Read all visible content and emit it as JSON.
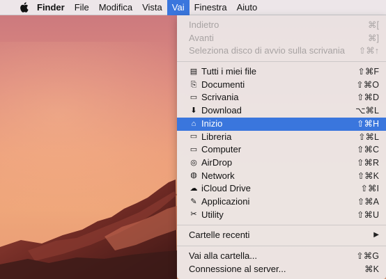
{
  "menubar": {
    "app_name": "Finder",
    "items": [
      "File",
      "Modifica",
      "Vista",
      "Vai",
      "Finestra",
      "Aiuto"
    ],
    "active_item": "Vai"
  },
  "menu": {
    "history": [
      {
        "label": "Indietro",
        "shortcut": "⌘[",
        "enabled": false
      },
      {
        "label": "Avanti",
        "shortcut": "⌘]",
        "enabled": false
      },
      {
        "label": "Seleziona disco di avvio sulla scrivania",
        "shortcut": "⇧⌘↑",
        "enabled": false
      }
    ],
    "places": [
      {
        "label": "Tutti i miei file",
        "shortcut": "⇧⌘F",
        "icon": "all-files-icon",
        "glyph": "▤"
      },
      {
        "label": "Documenti",
        "shortcut": "⇧⌘O",
        "icon": "documents-icon",
        "glyph": "⎘"
      },
      {
        "label": "Scrivania",
        "shortcut": "⇧⌘D",
        "icon": "desktop-icon",
        "glyph": "▭"
      },
      {
        "label": "Download",
        "shortcut": "⌥⌘L",
        "icon": "download-icon",
        "glyph": "⬇"
      },
      {
        "label": "Inizio",
        "shortcut": "⇧⌘H",
        "icon": "home-icon",
        "glyph": "⌂",
        "selected": true
      },
      {
        "label": "Libreria",
        "shortcut": "⇧⌘L",
        "icon": "library-folder-icon",
        "glyph": "▭"
      },
      {
        "label": "Computer",
        "shortcut": "⇧⌘C",
        "icon": "computer-icon",
        "glyph": "▭"
      },
      {
        "label": "AirDrop",
        "shortcut": "⇧⌘R",
        "icon": "airdrop-icon",
        "glyph": "◎"
      },
      {
        "label": "Network",
        "shortcut": "⇧⌘K",
        "icon": "network-globe-icon",
        "glyph": "◍"
      },
      {
        "label": "iCloud Drive",
        "shortcut": "⇧⌘I",
        "icon": "icloud-icon",
        "glyph": "☁"
      },
      {
        "label": "Applicazioni",
        "shortcut": "⇧⌘A",
        "icon": "applications-icon",
        "glyph": "✎"
      },
      {
        "label": "Utility",
        "shortcut": "⇧⌘U",
        "icon": "utility-tools-icon",
        "glyph": "✂"
      }
    ],
    "recent": {
      "label": "Cartelle recenti",
      "arrow": "▶"
    },
    "go": [
      {
        "label": "Vai alla cartella...",
        "shortcut": "⇧⌘G"
      },
      {
        "label": "Connessione al server...",
        "shortcut": "⌘K"
      }
    ]
  },
  "colors": {
    "highlight": "#3a76dd",
    "disabled": "#a8a3a3"
  }
}
